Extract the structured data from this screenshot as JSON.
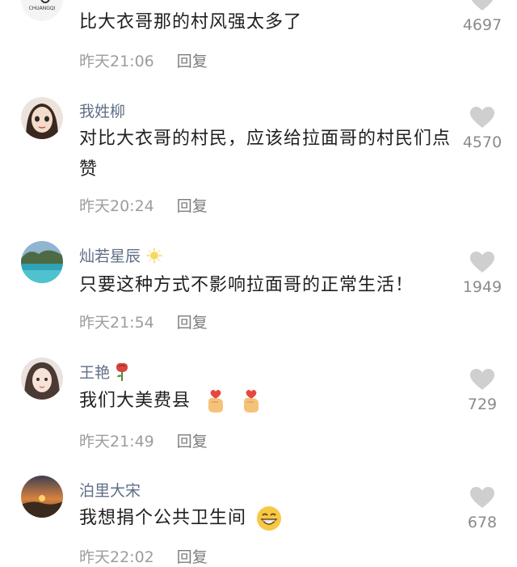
{
  "comments": [
    {
      "username": "",
      "text": "比大衣哥那的村风强太多了",
      "time": "昨天21:06",
      "reply": "回复",
      "likes": "4697",
      "avatar_logo_text": "CHUANGQI"
    },
    {
      "username": "我姓柳",
      "text": "对比大衣哥的村民，应该给拉面哥的村民们点赞",
      "time": "昨天20:24",
      "reply": "回复",
      "likes": "4570"
    },
    {
      "username": "灿若星辰",
      "username_emoji": "sun-emoji",
      "text": "只要这种方式不影响拉面哥的正常生活！",
      "time": "昨天21:54",
      "reply": "回复",
      "likes": "1949"
    },
    {
      "username": "王艳",
      "username_emoji": "rose-emoji",
      "text": "我们大美费县",
      "text_emoji": "finger-heart-emoji",
      "time": "昨天21:49",
      "reply": "回复",
      "likes": "729"
    },
    {
      "username": "泊里大宋",
      "text": "我想捐个公共卫生间",
      "text_emoji": "grinning-face-emoji",
      "time": "昨天22:02",
      "reply": "回复",
      "likes": "678"
    }
  ],
  "colors": {
    "username": "#5f6f86",
    "meta": "#9d9d9d",
    "heart": "#cfcfcf"
  }
}
